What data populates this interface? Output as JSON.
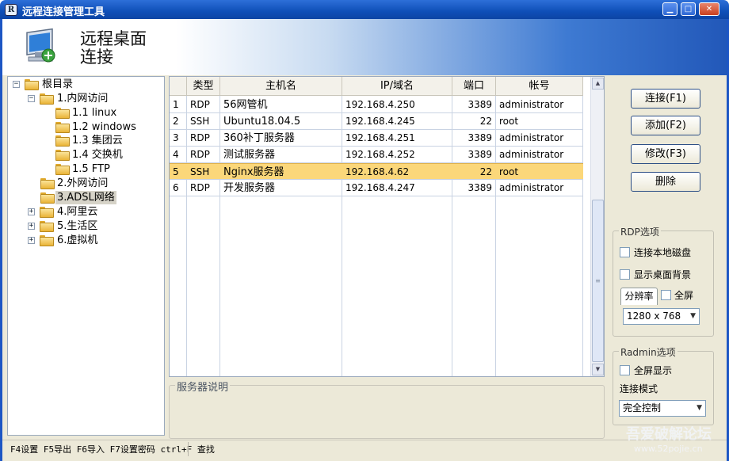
{
  "window": {
    "title": "远程连接管理工具",
    "app_icon_text": "R"
  },
  "banner": {
    "title_line1": "远程桌面",
    "title_line2": "连接"
  },
  "tree": [
    {
      "label": "根目录",
      "expander": "−"
    },
    {
      "label": "1.内网访问",
      "expander": "−"
    },
    {
      "label": "1.1 linux"
    },
    {
      "label": "1.2 windows"
    },
    {
      "label": "1.3 集团云"
    },
    {
      "label": "1.4 交换机"
    },
    {
      "label": "1.5 FTP"
    },
    {
      "label": "2.外网访问"
    },
    {
      "label": "3.ADSL网络",
      "selected": true
    },
    {
      "label": "4.阿里云",
      "expander": "+"
    },
    {
      "label": "5.生活区",
      "expander": "+"
    },
    {
      "label": "6.虚拟机",
      "expander": "+"
    }
  ],
  "table": {
    "headers": [
      "",
      "类型",
      "主机名",
      "IP/域名",
      "端口",
      "帐号"
    ],
    "rows": [
      {
        "num": "1",
        "type": "RDP",
        "host": "56网管机",
        "ip": "192.168.4.250",
        "port": "3389",
        "account": "administrator"
      },
      {
        "num": "2",
        "type": "SSH",
        "host": "Ubuntu18.04.5",
        "ip": "192.168.4.245",
        "port": "22",
        "account": "root"
      },
      {
        "num": "3",
        "type": "RDP",
        "host": "360补丁服务器",
        "ip": "192.168.4.251",
        "port": "3389",
        "account": "administrator"
      },
      {
        "num": "4",
        "type": "RDP",
        "host": "测试服务器",
        "ip": "192.168.4.252",
        "port": "3389",
        "account": "administrator"
      },
      {
        "num": "5",
        "type": "SSH",
        "host": "Nginx服务器",
        "ip": "192.168.4.62",
        "port": "22",
        "account": "root",
        "selected": true
      },
      {
        "num": "6",
        "type": "RDP",
        "host": "开发服务器",
        "ip": "192.168.4.247",
        "port": "3389",
        "account": "administrator"
      }
    ],
    "highlight_color": "#fbd77a"
  },
  "description": {
    "label": "服务器说明"
  },
  "buttons": {
    "connect": "连接(F1)",
    "add": "添加(F2)",
    "edit": "修改(F3)",
    "delete": "删除"
  },
  "rdp": {
    "group_label": "RDP选项",
    "local_disk": "连接本地磁盘",
    "show_bg": "显示桌面背景",
    "tab_resolution": "分辨率",
    "fullscreen": "全屏",
    "resolution": "1280 x 768"
  },
  "radmin": {
    "group_label": "Radmin选项",
    "fullscreen": "全屏显示",
    "mode_label": "连接模式",
    "mode": "完全控制"
  },
  "status": {
    "text": "F4设置  F5导出  F6导入  F7设置密码   ctrl+F 查找"
  },
  "watermark": {
    "line1": "吾爱破解论坛",
    "line2": "www.52pojie.cn"
  }
}
